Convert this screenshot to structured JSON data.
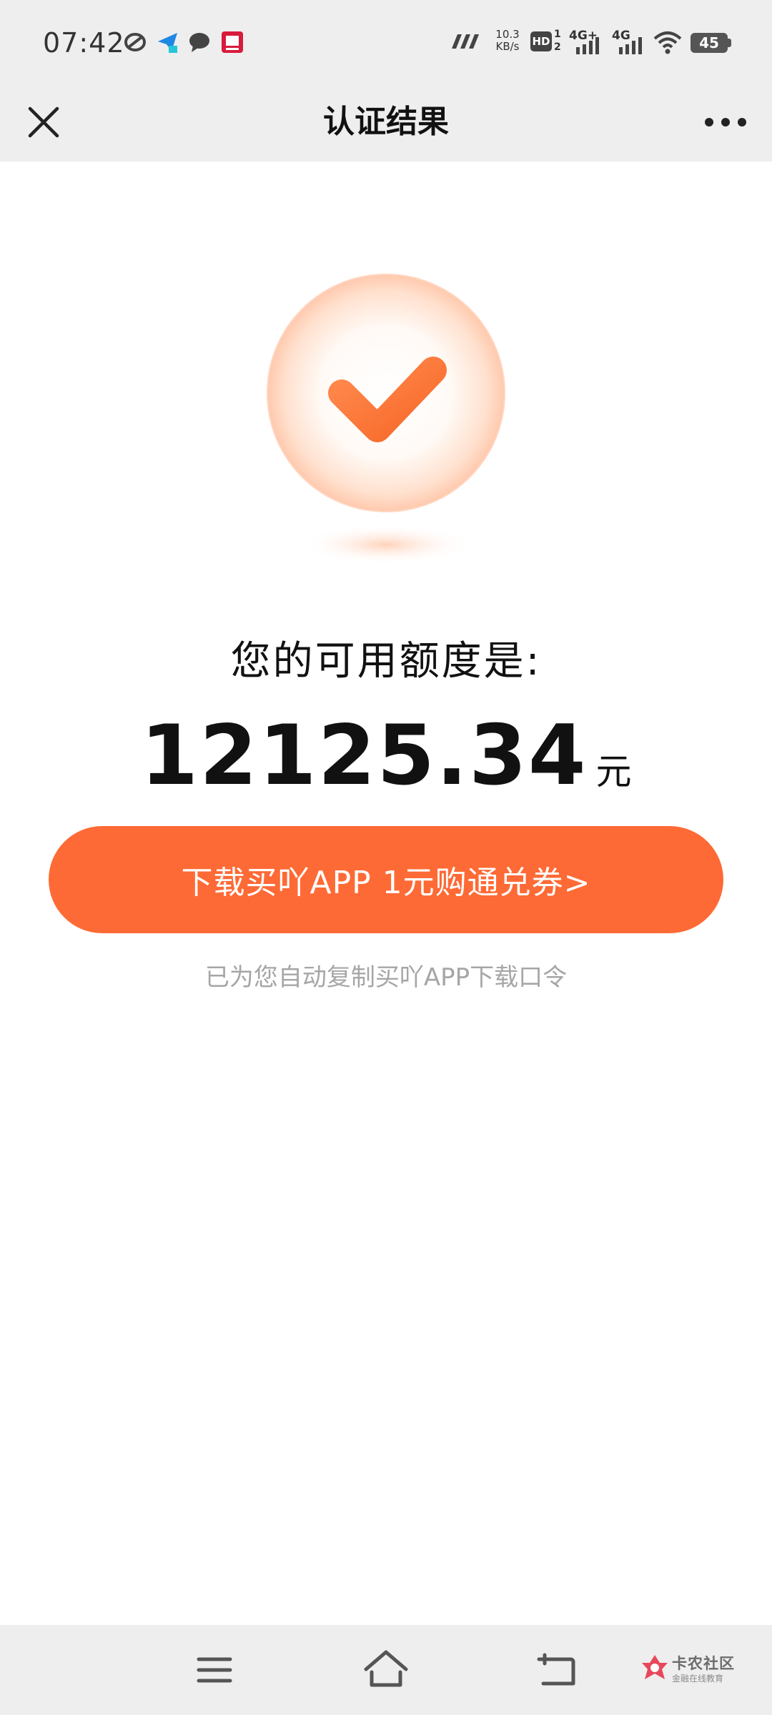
{
  "status_bar": {
    "time": "07:42",
    "net_speed_value": "10.3",
    "net_speed_unit": "KB/s",
    "hd_label": "HD",
    "sim1_label": "4G+",
    "sim2_label": "4G",
    "battery": "45",
    "icons": [
      "sync-icon",
      "send-icon",
      "chat-icon",
      "app-icon",
      "carrier-icon",
      "hd-icon",
      "signal-icon",
      "signal-icon",
      "wifi-icon",
      "battery-icon"
    ]
  },
  "header": {
    "title": "认证结果",
    "close_icon": "close-icon",
    "more_icon": "more-icon"
  },
  "main": {
    "status_icon": "check-icon",
    "quota_label": "您的可用额度是:",
    "amount": "12125.34",
    "amount_unit": "元",
    "download_button_label": "下载买吖APP 1元购通兑券>",
    "copy_hint": "已为您自动复制买吖APP下载口令"
  },
  "nav_bar": {
    "icons": [
      "menu-icon",
      "home-icon",
      "back-icon"
    ],
    "watermark_text": "卡农社区",
    "watermark_sub": "金融在线教育"
  },
  "colors": {
    "accent": "#fe6a35",
    "header_bg": "#eeeeee",
    "hint_text": "#a6a6a6"
  }
}
